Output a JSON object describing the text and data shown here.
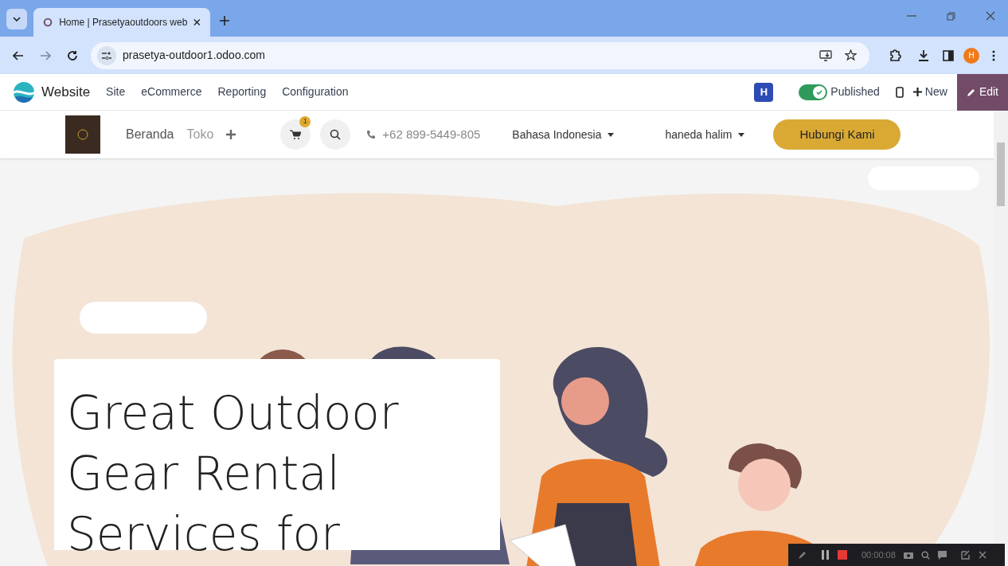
{
  "browser": {
    "tab_title": "Home | Prasetyaoutdoors web",
    "url": "prasetya-outdoor1.odoo.com",
    "profile_initial": "H"
  },
  "odoo_bar": {
    "app": "Website",
    "menu": [
      "Site",
      "eCommerce",
      "Reporting",
      "Configuration"
    ],
    "user_badge": "H",
    "published": {
      "label": "Published",
      "on": true
    },
    "new": "New",
    "edit": "Edit"
  },
  "site_header": {
    "nav": [
      {
        "label": "Beranda",
        "selected": true
      },
      {
        "label": "Toko",
        "selected": false
      }
    ],
    "cart_count": "1",
    "phone": "+62 899-5449-805",
    "language": "Bahasa Indonesia",
    "user": "haneda halim",
    "cta": "Hubungi Kami"
  },
  "hero": {
    "heading": "Great Outdoor Gear Rental Services for"
  },
  "recorder": {
    "time": "00:00:08"
  }
}
